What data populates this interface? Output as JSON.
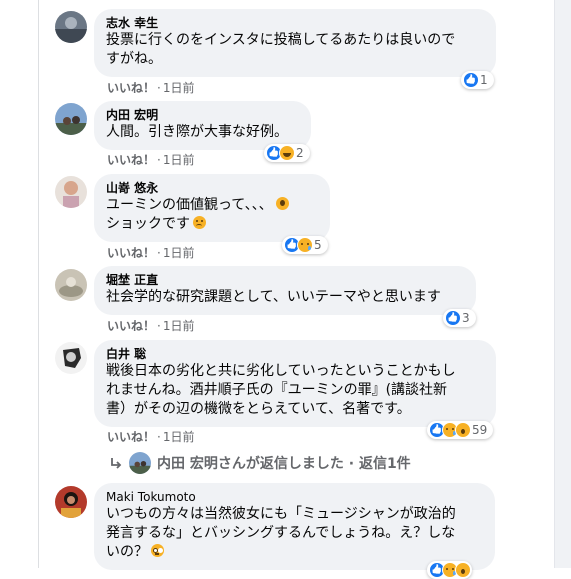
{
  "like_label": "いいね！",
  "separator": "·",
  "comments": [
    {
      "author": "志水 幸生",
      "lines": [
        "投票に行くのをインスタに投稿してるあたりは良いので",
        "すがね。"
      ],
      "time": "1日前",
      "reaction_count": "1",
      "reaction_icons": [
        "like-icon"
      ]
    },
    {
      "author": "内田 宏明",
      "lines": [
        "人間。引き際が大事な好例。"
      ],
      "time": "1日前",
      "reaction_count": "2",
      "reaction_icons": [
        "like-icon",
        "haha-icon"
      ]
    },
    {
      "author": "山嵜 悠永",
      "lines": [
        "ユーミンの価値観って、、、",
        "ショックです"
      ],
      "line_emojis": [
        "scream-emoji",
        "sad-emoji"
      ],
      "time": "1日前",
      "reaction_count": "5",
      "reaction_icons": [
        "like-icon",
        "sad-icon"
      ]
    },
    {
      "author": "堀埜 正直",
      "lines": [
        "社会学的な研究課題として、いいテーマやと思います"
      ],
      "time": "1日前",
      "reaction_count": "3",
      "reaction_icons": [
        "like-icon"
      ]
    },
    {
      "author": "白井 聡",
      "lines": [
        "戦後日本の劣化と共に劣化していったということかもし",
        "れませんね。酒井順子氏の『ユーミンの罪』(講談社新",
        "書）がその辺の機微をとらえていて、名著です。"
      ],
      "time": "1日前",
      "reaction_count": "59",
      "reaction_icons": [
        "like-icon",
        "sad-icon",
        "wow-icon"
      ]
    },
    {
      "author": "Maki Tokumoto",
      "lines": [
        "いつもの方々は当然彼女にも「ミュージシャンが政治的",
        "発言するな」とバッシングするんでしょうね。え？しな",
        "いの？"
      ],
      "line_emojis": [
        "flushed-emoji"
      ]
    }
  ],
  "reply_summary": {
    "text": "内田 宏明さんが返信しました · 返信1件"
  },
  "colors": {
    "bubble": "#f0f2f5",
    "meta_text": "#65676b",
    "like_blue": "#1877f2",
    "emoji_yellow": "#f7b125"
  }
}
